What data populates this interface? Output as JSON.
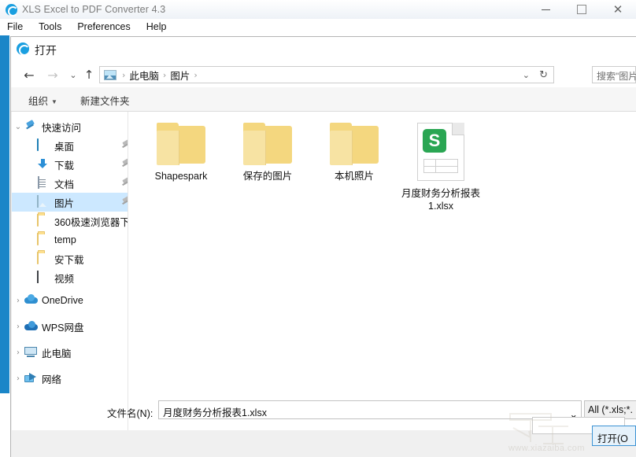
{
  "app": {
    "title": "XLS Excel to PDF Converter 4.3",
    "icon": "refresh-circle-icon",
    "menu": [
      "File",
      "Tools",
      "Preferences",
      "Help"
    ],
    "window_buttons": {
      "minimize": "minimize-icon",
      "maximize": "maximize-icon",
      "close": "✕"
    }
  },
  "dialog": {
    "title": "打开",
    "icon": "refresh-circle-icon",
    "nav": {
      "back": "←",
      "forward": "→",
      "recent": "⌄",
      "up": "↑"
    },
    "breadcrumb": {
      "icon": "pictures-icon",
      "items": [
        "此电脑",
        "图片"
      ],
      "separator": "›",
      "dropdown": "⌄",
      "refresh": "↻"
    },
    "search": {
      "placeholder": "搜索\"图片\""
    },
    "toolbar": {
      "organize": "组织",
      "organize_caret": "▼",
      "new_folder": "新建文件夹"
    },
    "sidebar": {
      "groups": [
        {
          "label": "快速访问",
          "icon": "pin-icon",
          "expanded": true,
          "twisty": "⌄",
          "items": [
            {
              "label": "桌面",
              "icon": "desktop-icon",
              "pinned": true,
              "selected": false
            },
            {
              "label": "下载",
              "icon": "download-icon",
              "pinned": true,
              "selected": false
            },
            {
              "label": "文档",
              "icon": "documents-icon",
              "pinned": true,
              "selected": false
            },
            {
              "label": "图片",
              "icon": "pictures-icon",
              "pinned": true,
              "selected": true
            },
            {
              "label": "360极速浏览器下",
              "icon": "folder-icon",
              "pinned": false,
              "selected": false
            },
            {
              "label": "temp",
              "icon": "folder-icon",
              "pinned": false,
              "selected": false
            },
            {
              "label": "安下载",
              "icon": "folder-icon",
              "pinned": false,
              "selected": false
            },
            {
              "label": "视频",
              "icon": "video-icon",
              "pinned": false,
              "selected": false
            }
          ]
        },
        {
          "label": "OneDrive",
          "icon": "onedrive-cloud-icon",
          "expanded": false,
          "twisty": "›",
          "items": []
        },
        {
          "label": "WPS网盘",
          "icon": "wps-cloud-icon",
          "expanded": false,
          "twisty": "›",
          "items": []
        },
        {
          "label": "此电脑",
          "icon": "this-pc-icon",
          "expanded": false,
          "twisty": "›",
          "items": []
        },
        {
          "label": "网络",
          "icon": "network-icon",
          "expanded": false,
          "twisty": "›",
          "items": []
        }
      ],
      "scrollbar": {
        "up": "⌃",
        "down": "⌄"
      }
    },
    "files": [
      {
        "name": "Shapespark",
        "type": "folder",
        "icon": "folder-icon"
      },
      {
        "name": "保存的图片",
        "type": "folder",
        "icon": "folder-icon"
      },
      {
        "name": "本机照片",
        "type": "folder",
        "icon": "folder-icon"
      },
      {
        "name": "月度财务分析报表1.xlsx",
        "type": "file",
        "icon": "wps-spreadsheet-icon",
        "badge": "S"
      }
    ],
    "footer": {
      "filename_label": "文件名(N):",
      "filename_value": "月度财务分析报表1.xlsx",
      "filename_caret": "⌄",
      "filter_value": "All (*.xls;*.",
      "open_button": "打开(O"
    }
  },
  "watermark": {
    "url": "www.xiazaiba.com",
    "mark": "下"
  },
  "colors": {
    "accent": "#1a9fe0",
    "selection": "#cce8ff",
    "folder": "#f4d77f",
    "wps_green": "#2aa653",
    "app_strip": "#1a86c8"
  }
}
